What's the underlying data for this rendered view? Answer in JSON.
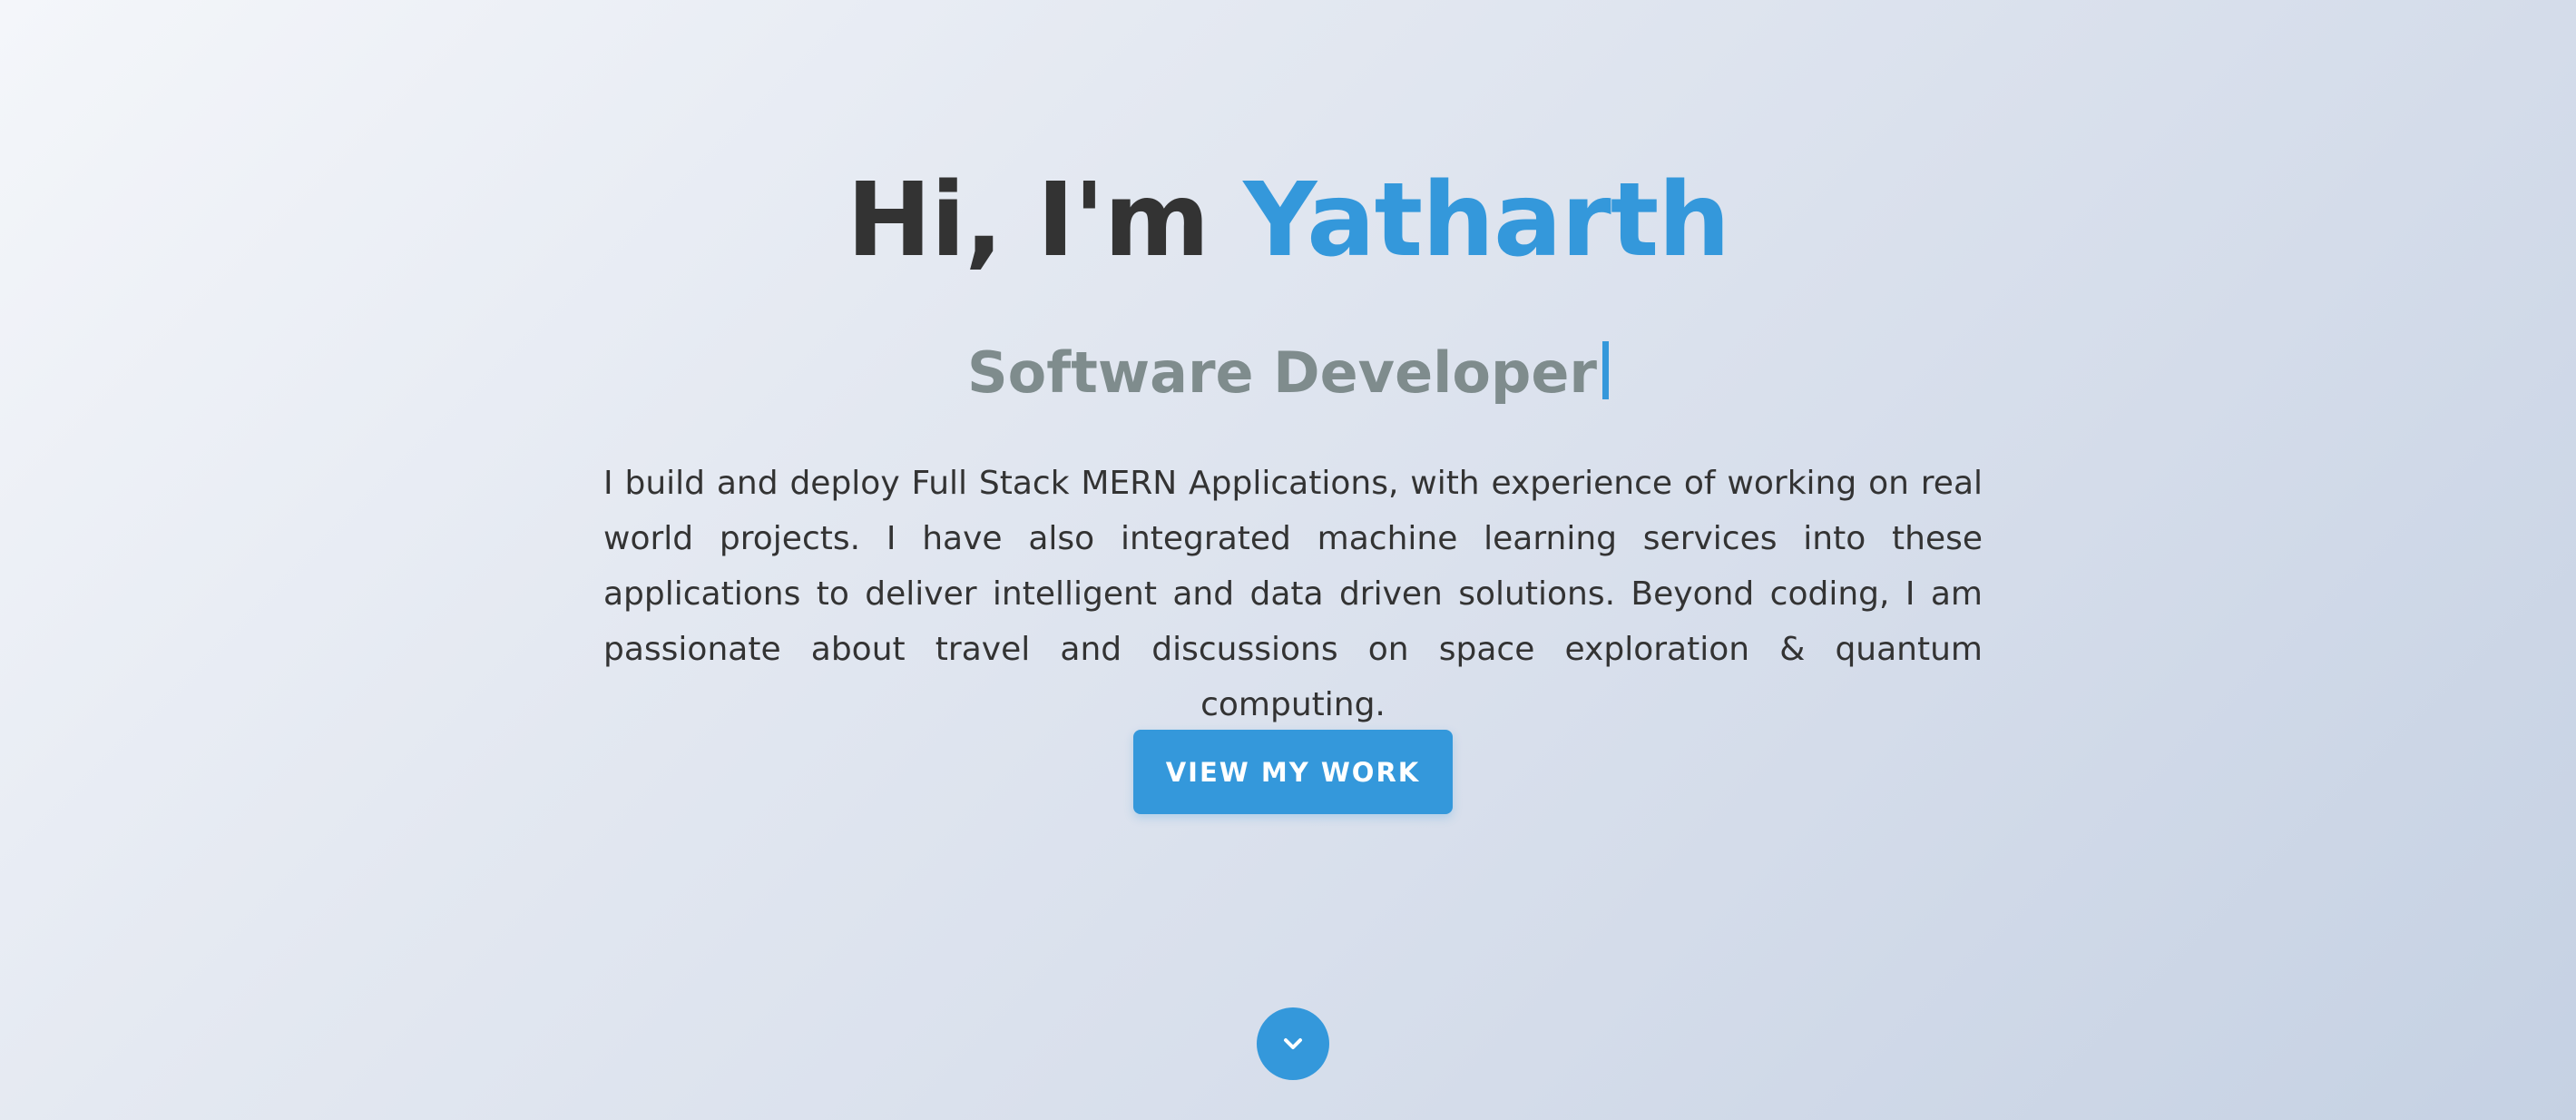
{
  "hero": {
    "greeting": "Hi, I'm",
    "name": "Yatharth",
    "role": "Software Developer",
    "description": "I build and deploy Full Stack MERN Applications, with experience of working on real world projects. I have also integrated machine learning services into these applications to deliver intelligent and data driven solutions. Beyond coding, I am passionate about travel and discussions on space exploration & quantum computing.",
    "cta_label": "VIEW MY WORK"
  },
  "icons": {
    "scroll": "chevron-down-icon"
  },
  "colors": {
    "accent": "#3498db",
    "heading": "#333333",
    "subtitle": "#7f8c8d",
    "text": "#333333",
    "button_text": "#ffffff"
  }
}
